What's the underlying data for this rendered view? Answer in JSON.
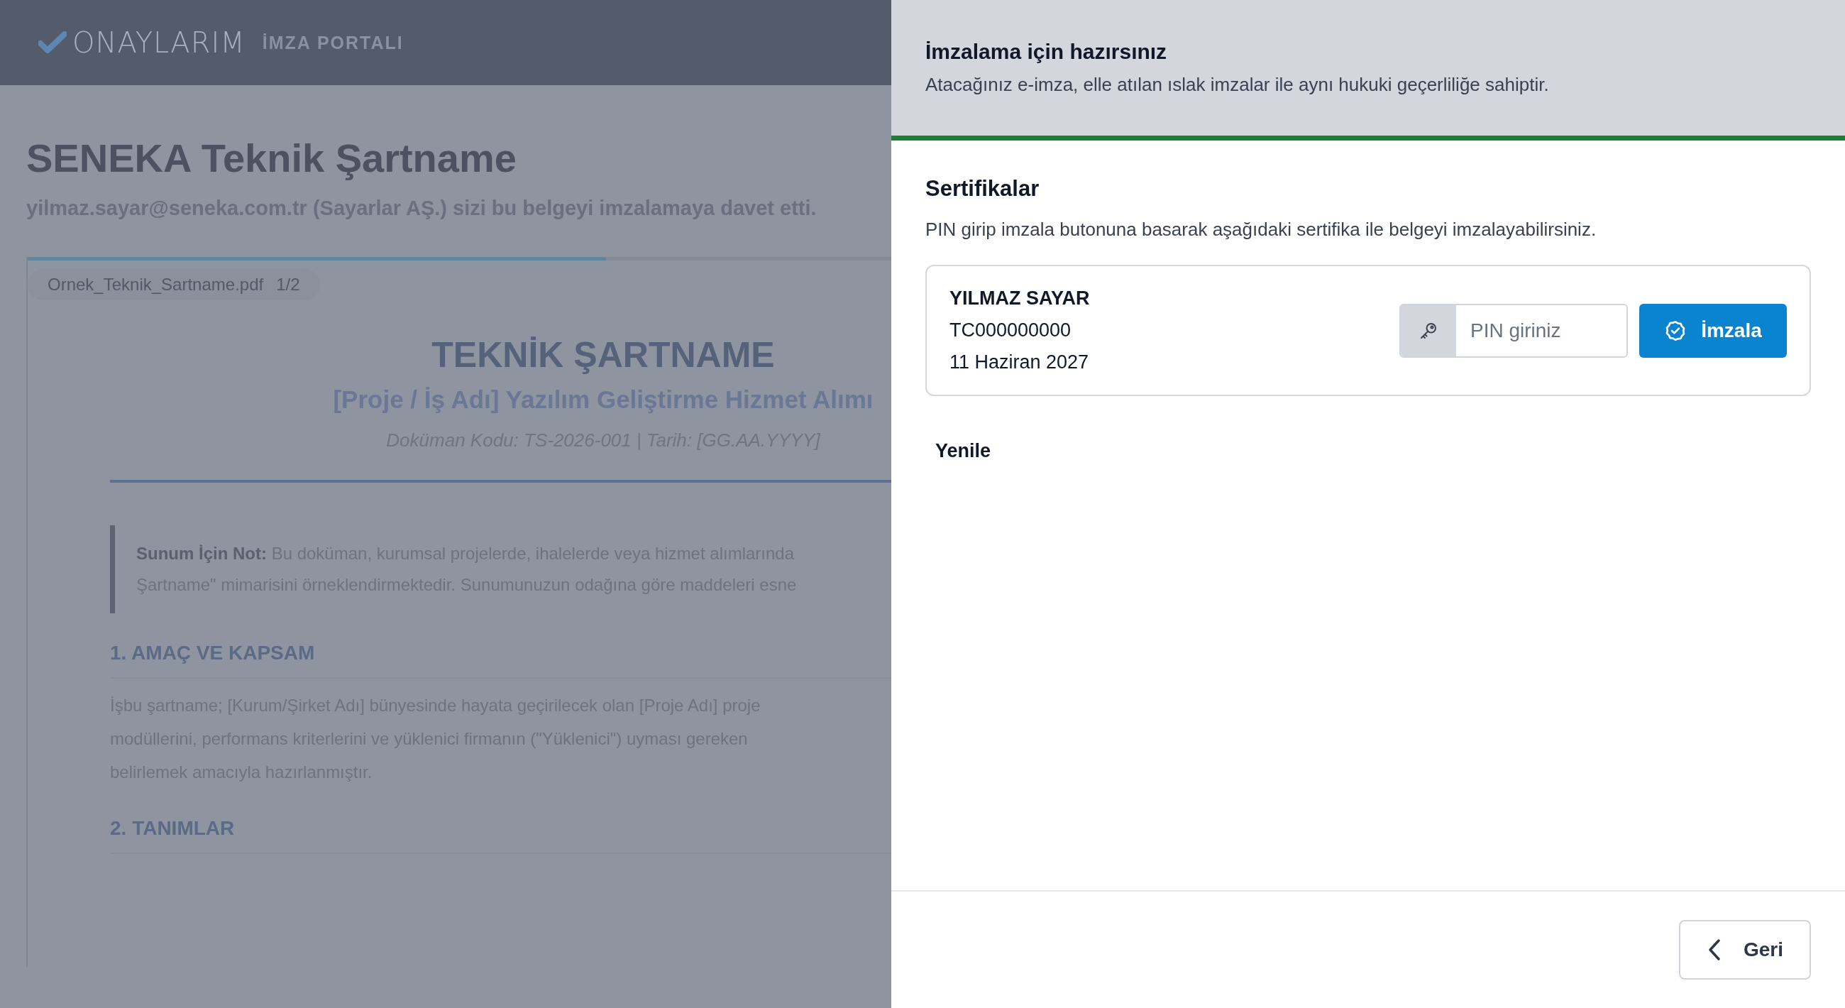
{
  "header": {
    "logo": "ONAYLARIM",
    "subtitle": "İMZA PORTALI"
  },
  "document": {
    "title": "SENEKA Teknik Şartname",
    "invitation": "yilmaz.sayar@seneka.com.tr (Sayarlar AŞ.) sizi bu belgeyi imzalamaya davet etti.",
    "load_bar": {
      "level": 0.67
    },
    "file_name": "Ornek_Teknik_Sartname.pdf",
    "page": "1/2",
    "content": {
      "title": "TEKNİK ŞARTNAME",
      "subtitle": "[Proje / İş Adı] Yazılım Geliştirme Hizmet Alımı",
      "meta": "Doküman Kodu: TS-2026-001 | Tarih: [GG.AA.YYYY]",
      "note_lines": [
        "**Sunum İçin Not:** Bu doküman, kurumsal projelerde, ihalelerde veya hizmet alımlarında",
        "Şartname\" mimarisini örneklendirmektedir. Sunumunuzun odağına göre maddeleri esne"
      ],
      "sections": [
        {
          "heading": "1. AMAÇ VE KAPSAM",
          "lines": [
            "İşbu şartname; [Kurum/Şirket Adı] bünyesinde hayata geçirilecek olan [Proje Adı] proje",
            "modüllerini, performans kriterlerini ve yüklenici firmanın (\"Yüklenici\") uyması gereken",
            "belirlemek amacıyla hazırlanmıştır."
          ]
        },
        {
          "heading": "2. TANIMLAR"
        }
      ]
    }
  },
  "drawer": {
    "title": "İmzalama için hazırsınız",
    "description": "Atacağınız e-imza, elle atılan ıslak imzalar ile aynı hukuki geçerliliğe sahiptir.",
    "certificates": {
      "title": "Sertifikalar",
      "description": "PIN girip imzala butonuna basarak aşağıdaki sertifika ile belgeyi imzalayabilirsiniz.",
      "items": [
        {
          "name": "YILMAZ SAYAR",
          "id": "TC000000000",
          "expiry": "11 Haziran 2027",
          "pin": {
            "placeholder": "PIN giriniz"
          },
          "sign_button": "İmzala"
        }
      ]
    },
    "refresh_button": "Yenile",
    "back_button": "Geri"
  }
}
